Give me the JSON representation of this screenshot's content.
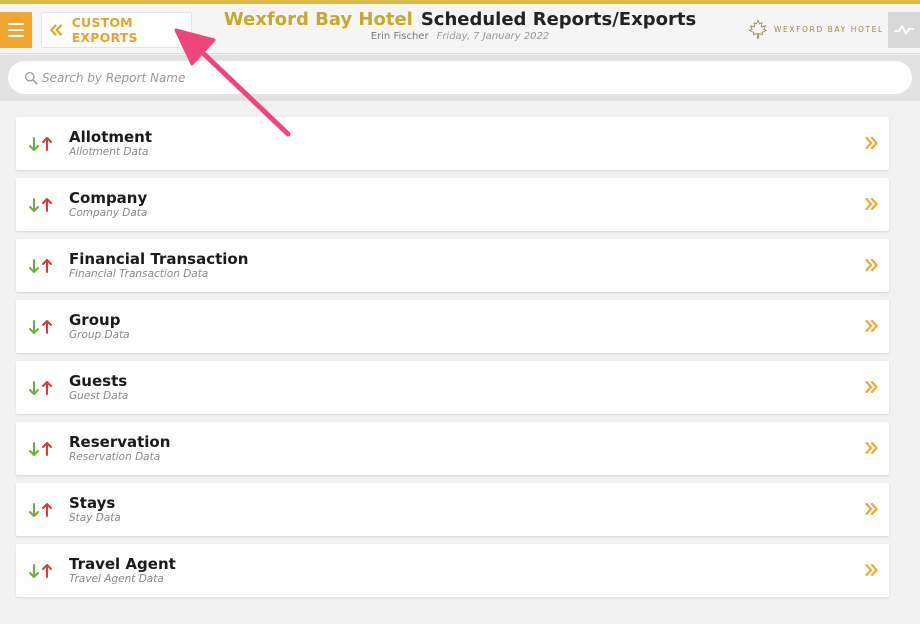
{
  "header": {
    "hotel_name": "Wexford Bay Hotel",
    "page_title": "Scheduled Reports/Exports",
    "user_name": "Erin Fischer",
    "date": "Friday, 7 January 2022",
    "back_label": "CUSTOM EXPORTS",
    "logo_text": "WEXFORD BAY HOTEL"
  },
  "search": {
    "placeholder": "Search by Report Name",
    "value": ""
  },
  "reports": [
    {
      "name": "Allotment",
      "description": "Allotment Data"
    },
    {
      "name": "Company",
      "description": "Company Data"
    },
    {
      "name": "Financial Transaction",
      "description": "Financial Transaction Data"
    },
    {
      "name": "Group",
      "description": "Group Data"
    },
    {
      "name": "Guests",
      "description": "Guest Data"
    },
    {
      "name": "Reservation",
      "description": "Reservation Data"
    },
    {
      "name": "Stays",
      "description": "Stay Data"
    },
    {
      "name": "Travel Agent",
      "description": "Travel Agent Data"
    }
  ],
  "colors": {
    "accent_orange": "#f0a830",
    "brand_gold": "#c8a82a",
    "arrow_down": "#6cad3f",
    "arrow_up": "#d93a3a",
    "annotation_pink": "#f0457c"
  }
}
